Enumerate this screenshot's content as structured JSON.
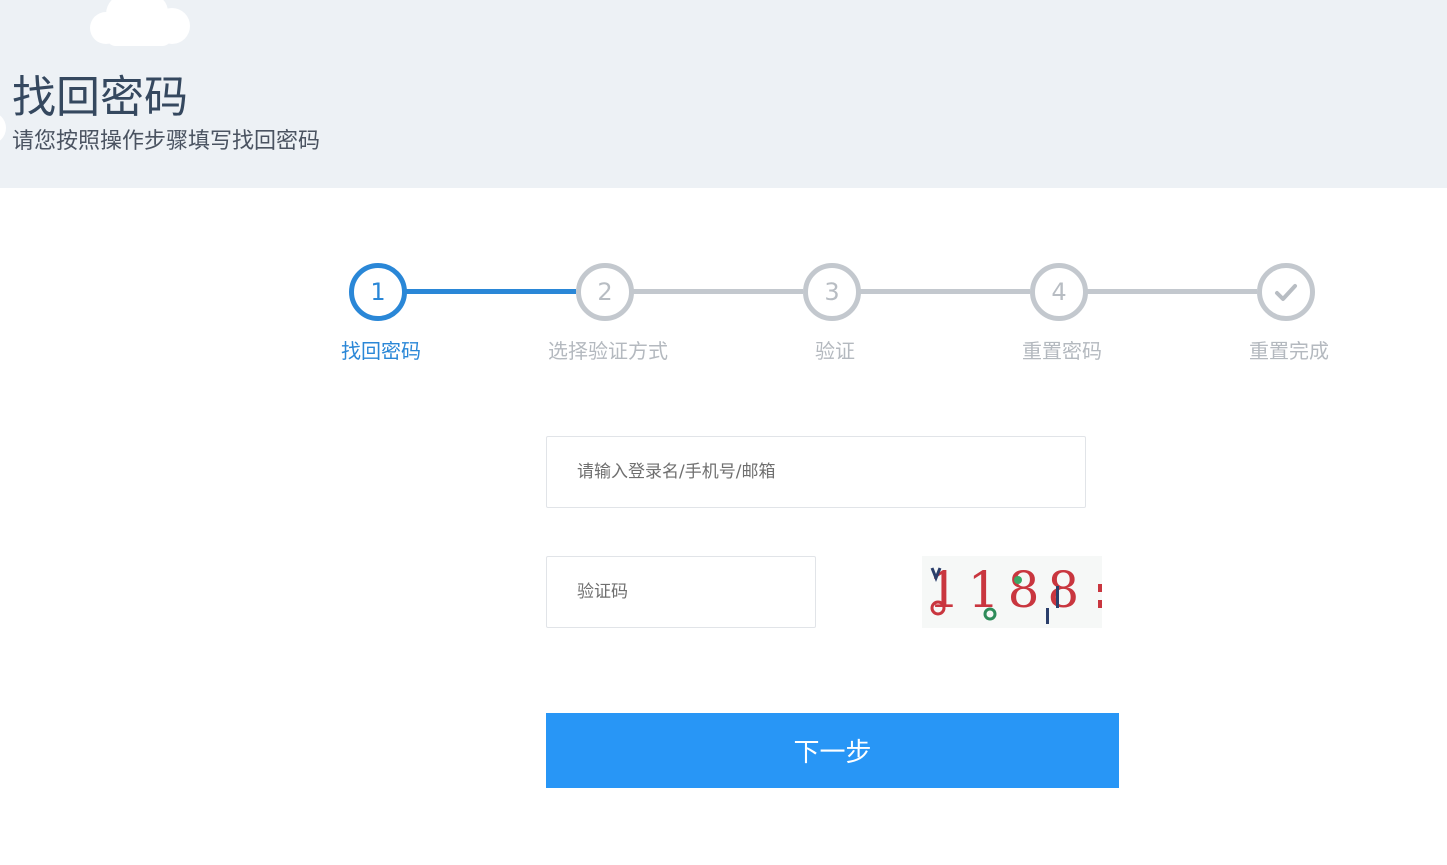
{
  "header": {
    "title": "找回密码",
    "subtitle": "请您按照操作步骤填写找回密码"
  },
  "steps": [
    {
      "number": "1",
      "label": "找回密码",
      "state": "active"
    },
    {
      "number": "2",
      "label": "选择验证方式",
      "state": "pending"
    },
    {
      "number": "3",
      "label": "验证",
      "state": "pending"
    },
    {
      "number": "4",
      "label": "重置密码",
      "state": "pending"
    },
    {
      "number": "",
      "label": "重置完成",
      "state": "pending",
      "icon": "check-icon"
    }
  ],
  "form": {
    "account_placeholder": "请输入登录名/手机号/邮箱",
    "captcha_placeholder": "验证码",
    "captcha_image_text": "1188",
    "next_label": "下一步"
  },
  "colors": {
    "active": "#2a87d7",
    "inactive": "#c3c8ce",
    "button": "#2896f6",
    "header_bg": "#edf1f5"
  }
}
